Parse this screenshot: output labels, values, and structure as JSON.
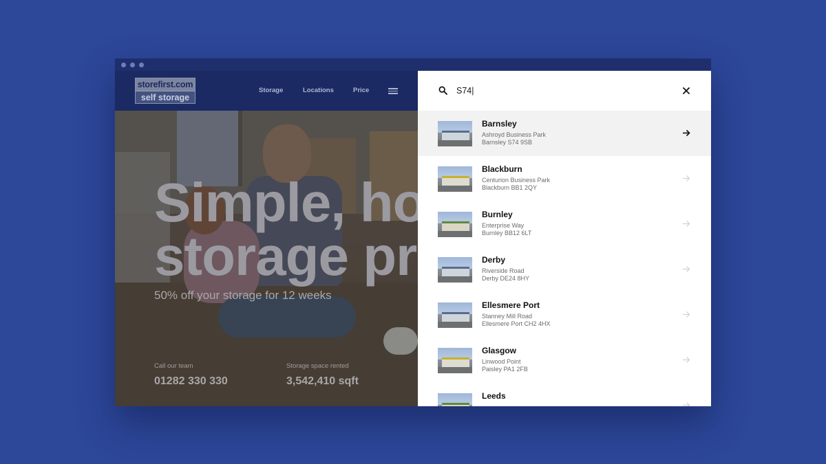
{
  "brand": {
    "top": "storefirst.com",
    "bottom": "self storage"
  },
  "nav": {
    "items": [
      "Storage",
      "Locations",
      "Price"
    ]
  },
  "hero": {
    "title_line1": "Simple, ho",
    "title_line2": "storage pr",
    "subtitle": "50% off your storage for 12 weeks",
    "stats": [
      {
        "label": "Call our team",
        "value": "01282 330 330"
      },
      {
        "label": "Storage space rented",
        "value": "3,542,410 sqft"
      }
    ]
  },
  "search": {
    "query": "S74|"
  },
  "results": [
    {
      "name": "Barnsley",
      "line1": "Ashroyd Business Park",
      "line2": "Barnsley S74 9SB",
      "active": true
    },
    {
      "name": "Blackburn",
      "line1": "Centurion Business Park",
      "line2": "Blackburn BB1 2QY",
      "active": false
    },
    {
      "name": "Burnley",
      "line1": "Enterprise Way",
      "line2": "Burnley BB12 6LT",
      "active": false
    },
    {
      "name": "Derby",
      "line1": "Riverside Road",
      "line2": "Derby DE24 8HY",
      "active": false
    },
    {
      "name": "Ellesmere Port",
      "line1": "Stanney Mill Road",
      "line2": "Ellesmere Port CH2 4HX",
      "active": false
    },
    {
      "name": "Glasgow",
      "line1": "Linwood Point",
      "line2": "Paisley PA1 2FB",
      "active": false
    },
    {
      "name": "Leeds",
      "line1": "",
      "line2": "",
      "active": false
    }
  ],
  "colors": {
    "background": "#2d4799",
    "header": "#1b2a63",
    "panel": "#ffffff",
    "active_row": "#f2f2f2"
  },
  "icons": [
    "search-icon",
    "close-icon",
    "menu-icon",
    "arrow-right-icon"
  ]
}
